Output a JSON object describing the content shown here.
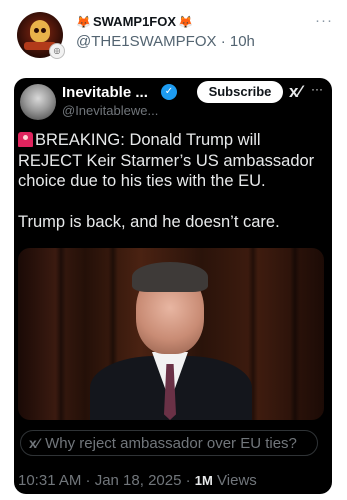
{
  "tweet": {
    "author_name": "SWAMP1FOX",
    "author_handle": "@THE1SWAMPFOX",
    "separator": "·",
    "time_ago": "10h",
    "more_icon": "more-horizontal-icon"
  },
  "quoted": {
    "name": "Inevitable ...",
    "handle": "@Inevitablewe...",
    "subscribe_label": "Subscribe",
    "grok_icon": "grok-icon",
    "line1": "BREAKING: Donald Trump will REJECT Keir Starmer’s US ambassador choice due to his ties with the EU.",
    "line2": "Trump is back, and he doesn’t care.",
    "grok_prompt": "Why reject ambassador over EU ties?",
    "timestamp": "10:31 AM · Jan 18, 2025 ·",
    "views_count": "1M",
    "views_label": "Views",
    "accent": "#1d9bf0"
  }
}
